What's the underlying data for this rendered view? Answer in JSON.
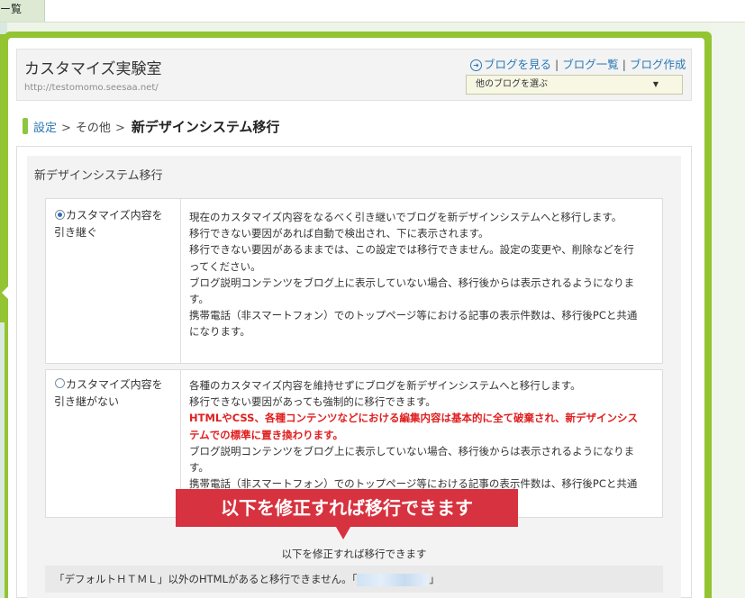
{
  "top_tab": {
    "label": "ー覧"
  },
  "header": {
    "blog_title": "カスタマイズ実験室",
    "blog_url": "http://testomomo.seesaa.net/",
    "links": {
      "view": "ブログを見る",
      "list": "ブログ一覧",
      "create": "ブログ作成",
      "separator": "|"
    },
    "blog_select": {
      "value": "他のブログを選ぶ",
      "caret": "▼"
    }
  },
  "breadcrumb": {
    "settings": "設定",
    "other": "その他",
    "current": "新デザインシステム移行",
    "arrow": ">"
  },
  "panel": {
    "title": "新デザインシステム移行",
    "option1": {
      "label": "カスタマイズ内容を引き継ぐ",
      "selected": true,
      "desc": [
        "現在のカスタマイズ内容をなるべく引き継いでブログを新デザインシステムへと移行します。",
        "移行できない要因があれば自動で検出され、下に表示されます。",
        "移行できない要因があるままでは、この設定では移行できません。設定の変更や、削除などを行ってください。",
        "ブログ説明コンテンツをブログ上に表示していない場合、移行後からは表示されるようになります。",
        "携帯電話（非スマートフォン）でのトップページ等における記事の表示件数は、移行後PCと共通になります。"
      ]
    },
    "option2": {
      "label": "カスタマイズ内容を引き継がない",
      "selected": false,
      "desc1": "各種のカスタマイズ内容を維持せずにブログを新デザインシステムへと移行します。",
      "desc2": "移行できない要因があっても強制的に移行できます。",
      "warning": "HTMLやCSS、各種コンテンツなどにおける編集内容は基本的に全て破棄され、新デザインシステムでの標準に置き換わります。",
      "desc3": "ブログ説明コンテンツをブログ上に表示していない場合、移行後からは表示されるようになります。",
      "desc4": "携帯電話（非スマートフォン）でのトップページ等における記事の表示件数は、移行後PCと共通になります。"
    },
    "callout": "以下を修正すれば移行できます",
    "fix_heading": "以下を修正すれば移行できます",
    "issue": {
      "prefix": "「デフォルトＨＴＭＬ」以外のHTMLがあると移行できません。「",
      "suffix": "」"
    }
  },
  "colors": {
    "frame_green": "#93c431",
    "link_blue": "#2a78b6",
    "warning_red": "#e02020",
    "callout_red": "#d7323f"
  },
  "icons": {
    "view": "circle-arrow-icon",
    "caret": "caret-down-icon"
  }
}
